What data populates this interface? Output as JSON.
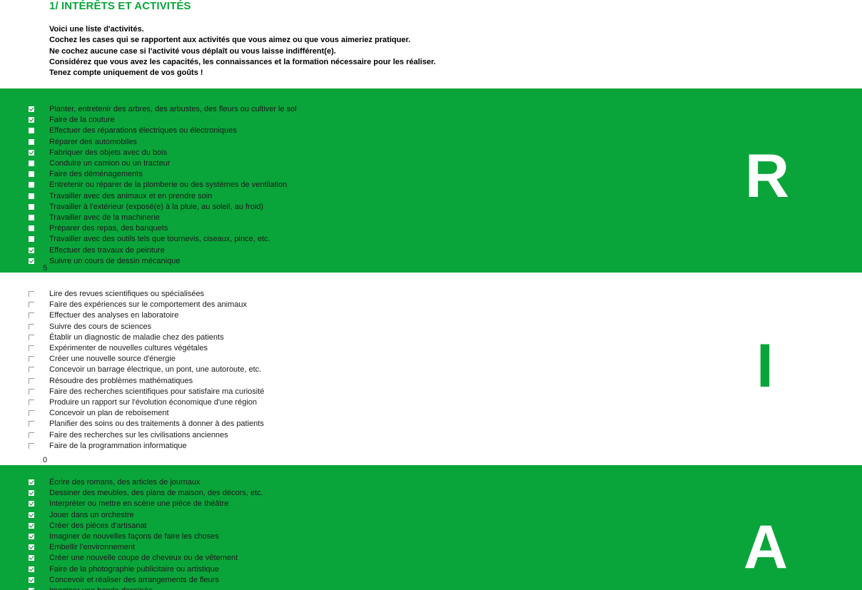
{
  "title": "1/ INTÉRÊTS ET ACTIVITÉS",
  "instructions": [
    "Voici une liste d'activités.",
    "Cochez les cases qui se rapportent aux activités que vous aimez ou que vous aimeriez pratiquer.",
    "Ne cochez aucune case si l'activité vous déplaît ou vous laisse indifférent(e).",
    "Considérez que vous avez les capacités, les connaissances et la formation nécessaire pour les réaliser.",
    "Tenez compte uniquement de vos goûts !"
  ],
  "colors": {
    "accent": "#0aa53a"
  },
  "sections": [
    {
      "letter": "R",
      "theme": "green",
      "count": "5",
      "items": [
        {
          "label": "Planter, entretenir des arbres, des arbustes, des fleurs ou cultiver le sol",
          "checked": true
        },
        {
          "label": "Faire de la couture",
          "checked": true
        },
        {
          "label": "Effectuer des réparations électriques ou électroniques",
          "checked": false
        },
        {
          "label": "Réparer des automobiles",
          "checked": false
        },
        {
          "label": "Fabriquer des objets avec du bois",
          "checked": true
        },
        {
          "label": "Conduire un camion ou un tracteur",
          "checked": false
        },
        {
          "label": "Faire des déménagements",
          "checked": false
        },
        {
          "label": "Entretenir ou réparer de la plomberie ou des systèmes de ventilation",
          "checked": false
        },
        {
          "label": "Travailler avec des animaux et en prendre soin",
          "checked": false
        },
        {
          "label": "Travailler à l'extérieur (exposé(e) à la pluie, au soleil, au froid)",
          "checked": false
        },
        {
          "label": "Travailler avec de la machinerie",
          "checked": false
        },
        {
          "label": "Préparer des repas, des banquets",
          "checked": false
        },
        {
          "label": "Travailler avec des outils tels que tournevis, ciseaux, pince, etc.",
          "checked": false
        },
        {
          "label": "Effectuer des travaux de peinture",
          "checked": true
        },
        {
          "label": "Suivre un cours de dessin mécanique",
          "checked": true
        }
      ]
    },
    {
      "letter": "I",
      "theme": "white",
      "count": "0",
      "items": [
        {
          "label": "Lire des revues scientifiques ou spécialisées",
          "checked": false
        },
        {
          "label": "Faire des expériences sur le comportement des animaux",
          "checked": false
        },
        {
          "label": "Effectuer des analyses en laboratoire",
          "checked": false
        },
        {
          "label": "Suivre des cours de sciences",
          "checked": false
        },
        {
          "label": "Établir un diagnostic de maladie chez des patients",
          "checked": false
        },
        {
          "label": "Expérimenter de nouvelles cultures végétales",
          "checked": false
        },
        {
          "label": "Créer une nouvelle source d'énergie",
          "checked": false
        },
        {
          "label": "Concevoir un barrage électrique, un pont, une autoroute, etc.",
          "checked": false
        },
        {
          "label": "Résoudre des problèmes mathématiques",
          "checked": false
        },
        {
          "label": "Faire des recherches scientifiques pour satisfaire ma curiosité",
          "checked": false
        },
        {
          "label": "Produire un rapport sur l'évolution économique d'une région",
          "checked": false
        },
        {
          "label": "Concevoir un plan de reboisement",
          "checked": false
        },
        {
          "label": "Planifier des soins ou des traitements à donner à des patients",
          "checked": false
        },
        {
          "label": "Faire des recherches sur les civilisations anciennes",
          "checked": false
        },
        {
          "label": "Faire de la programmation informatique",
          "checked": false
        }
      ]
    },
    {
      "letter": "A",
      "theme": "green",
      "count": "",
      "items": [
        {
          "label": "Écrire des romans, des articles de journaux",
          "checked": true
        },
        {
          "label": "Dessiner des meubles, des plans de maison, des décors, etc.",
          "checked": true
        },
        {
          "label": "Interpréter ou mettre en scène une pièce de théâtre",
          "checked": true
        },
        {
          "label": "Jouer dans un orchestre",
          "checked": true
        },
        {
          "label": "Créer des pièces d'artisanat",
          "checked": true
        },
        {
          "label": "Imaginer de nouvelles façons de faire les choses",
          "checked": true
        },
        {
          "label": "Embellir l'environnement",
          "checked": true
        },
        {
          "label": "Créer une nouvelle coupe de cheveux ou de vêtement",
          "checked": true
        },
        {
          "label": "Faire de la photographie publicitaire ou artistique",
          "checked": true
        },
        {
          "label": "Concevoir et réaliser des arrangements de fleurs",
          "checked": true
        },
        {
          "label": "Imaginer une bande dessinée",
          "checked": true
        }
      ]
    }
  ]
}
